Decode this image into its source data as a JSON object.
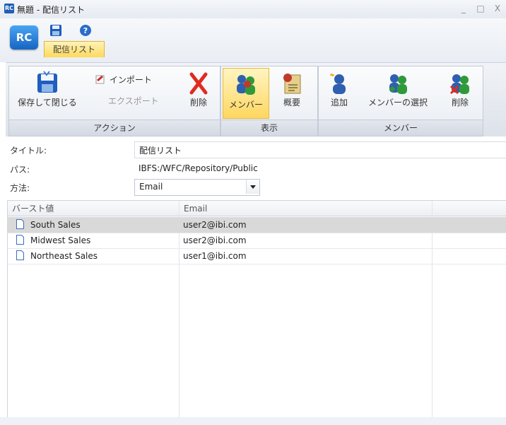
{
  "window": {
    "app_badge": "RC",
    "title": "無題 - 配信リスト",
    "minimize": "_",
    "maximize": "□",
    "close": "X"
  },
  "app": {
    "logo_text": "RC"
  },
  "ribbon": {
    "tab_label": "配信リスト",
    "groups": {
      "actions": {
        "label": "アクション",
        "save_close": "保存して閉じる",
        "import": "インポート",
        "export": "エクスポート",
        "delete": "削除"
      },
      "view": {
        "label": "表示",
        "members": "メンバー",
        "summary": "概要"
      },
      "members": {
        "label": "メンバー",
        "add": "追加",
        "select_members": "メンバーの選択",
        "delete": "削除"
      }
    }
  },
  "form": {
    "title_label": "タイトル:",
    "title_value": "配信リスト",
    "path_label": "パス:",
    "path_value": "IBFS:/WFC/Repository/Public",
    "method_label": "方法:",
    "method_value": "Email"
  },
  "grid": {
    "columns": [
      "バースト値",
      "Email"
    ],
    "rows": [
      {
        "burst": "South Sales",
        "email": "user2@ibi.com",
        "selected": true
      },
      {
        "burst": "Midwest Sales",
        "email": "user2@ibi.com",
        "selected": false
      },
      {
        "burst": "Northeast Sales",
        "email": "user1@ibi.com",
        "selected": false
      }
    ]
  },
  "colors": {
    "accent": "#1f5fb4",
    "tab_active": "#ffd95a",
    "selected_row": "#d9d9d9"
  }
}
